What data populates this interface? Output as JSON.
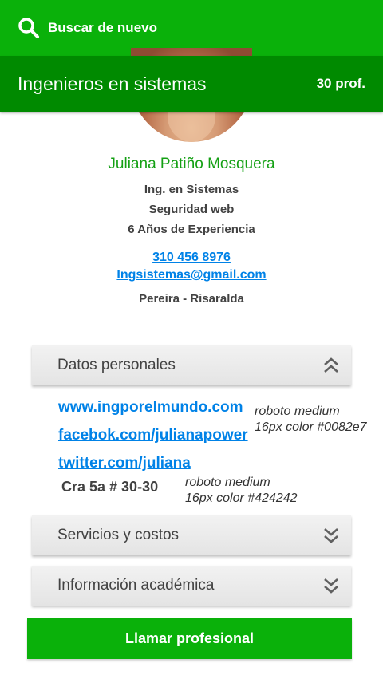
{
  "topbar": {
    "search_icon": "search-icon",
    "search_label": "Buscar de nuevo",
    "color": "#0ab10a"
  },
  "titlebar": {
    "title": "Ingenieros en sistemas",
    "count": "30 prof.",
    "color": "#008a00"
  },
  "profile": {
    "name": "Juliana Patiño Mosquera",
    "profession": "Ing. en Sistemas",
    "specialty": "Seguridad web",
    "experience": "6 Años de Experiencia",
    "phone": "310 456 8976",
    "email": "Ingsistemas@gmail.com",
    "location": "Pereira - Risaralda"
  },
  "sections": {
    "personal": {
      "label": "Datos personales",
      "icon": "chevron-double-up-icon"
    },
    "services": {
      "label": "Servicios y costos",
      "icon": "chevron-double-down-icon"
    },
    "academic": {
      "label": "Información académica",
      "icon": "chevron-double-down-icon"
    }
  },
  "personal_data": {
    "website": "www.ingporelmundo.com",
    "facebook": "facebok.com/julianapower",
    "twitter": "twitter.com/juliana",
    "address": "Cra 5a # 30-30"
  },
  "annotations": {
    "links_note_line1": "roboto medium",
    "links_note_line2": "16px color #0082e7",
    "address_note_line1": "roboto medium",
    "address_note_line2": "16px color #424242"
  },
  "call_button": {
    "label": "Llamar profesional"
  },
  "colors": {
    "link": "#0082e7",
    "text": "#424242",
    "name": "#14a014"
  }
}
